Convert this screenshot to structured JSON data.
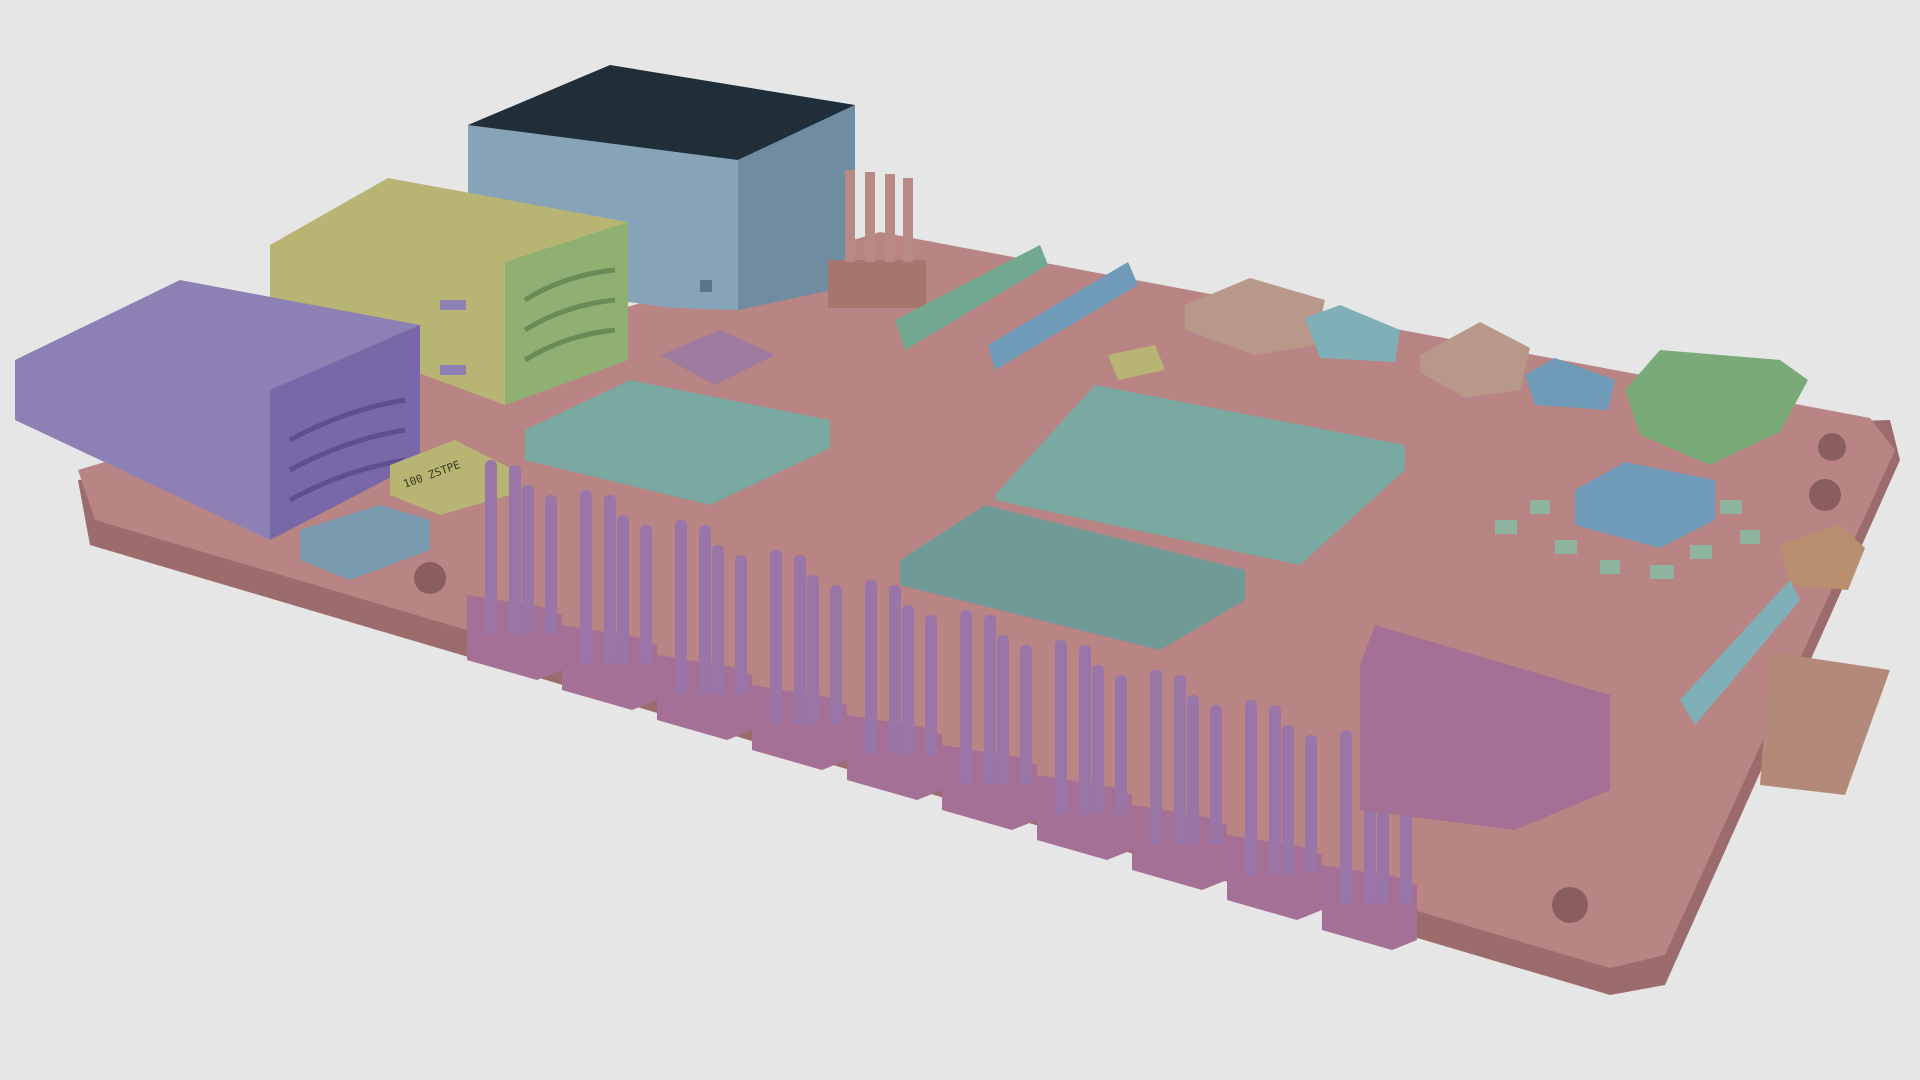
{
  "scene": {
    "subject": "",
    "background_color": "#e6e6e6"
  },
  "colors": {
    "board": "#b98484",
    "board_edge": "#9c6b6b",
    "pin_header": "#a47096",
    "pins": "#9a76a8",
    "usb_purple": "#8c80b4",
    "usb_yellow": "#b8b474",
    "ethernet": "#86a3b8",
    "ethernet_top": "#1f2e38",
    "heatsink_teal": "#79a9a0",
    "chip_blue": "#6f9ab8",
    "usbc_green": "#7aaa78",
    "sdcard": "#b38a7a"
  },
  "components": {
    "usb_port_a": "usb-a-port",
    "usb_port_b": "usb-a-port",
    "ethernet_port": "rj45-ethernet-jack",
    "gpio_header": "gpio-pin-header",
    "soc_chip": "soc-chip",
    "ram_chip": "ram-chip",
    "pmic_chip": "pmic-chip",
    "usbc_port": "usb-c-port",
    "micro_hdmi_a": "micro-hdmi-port",
    "micro_hdmi_b": "micro-hdmi-port",
    "audio_jack": "audio-jack",
    "sd_card": "microsd-card",
    "csi_connector": "ribbon-connector",
    "dsi_connector": "ribbon-connector"
  },
  "silkscreen": {
    "part_label": "100 ZSTPE"
  }
}
